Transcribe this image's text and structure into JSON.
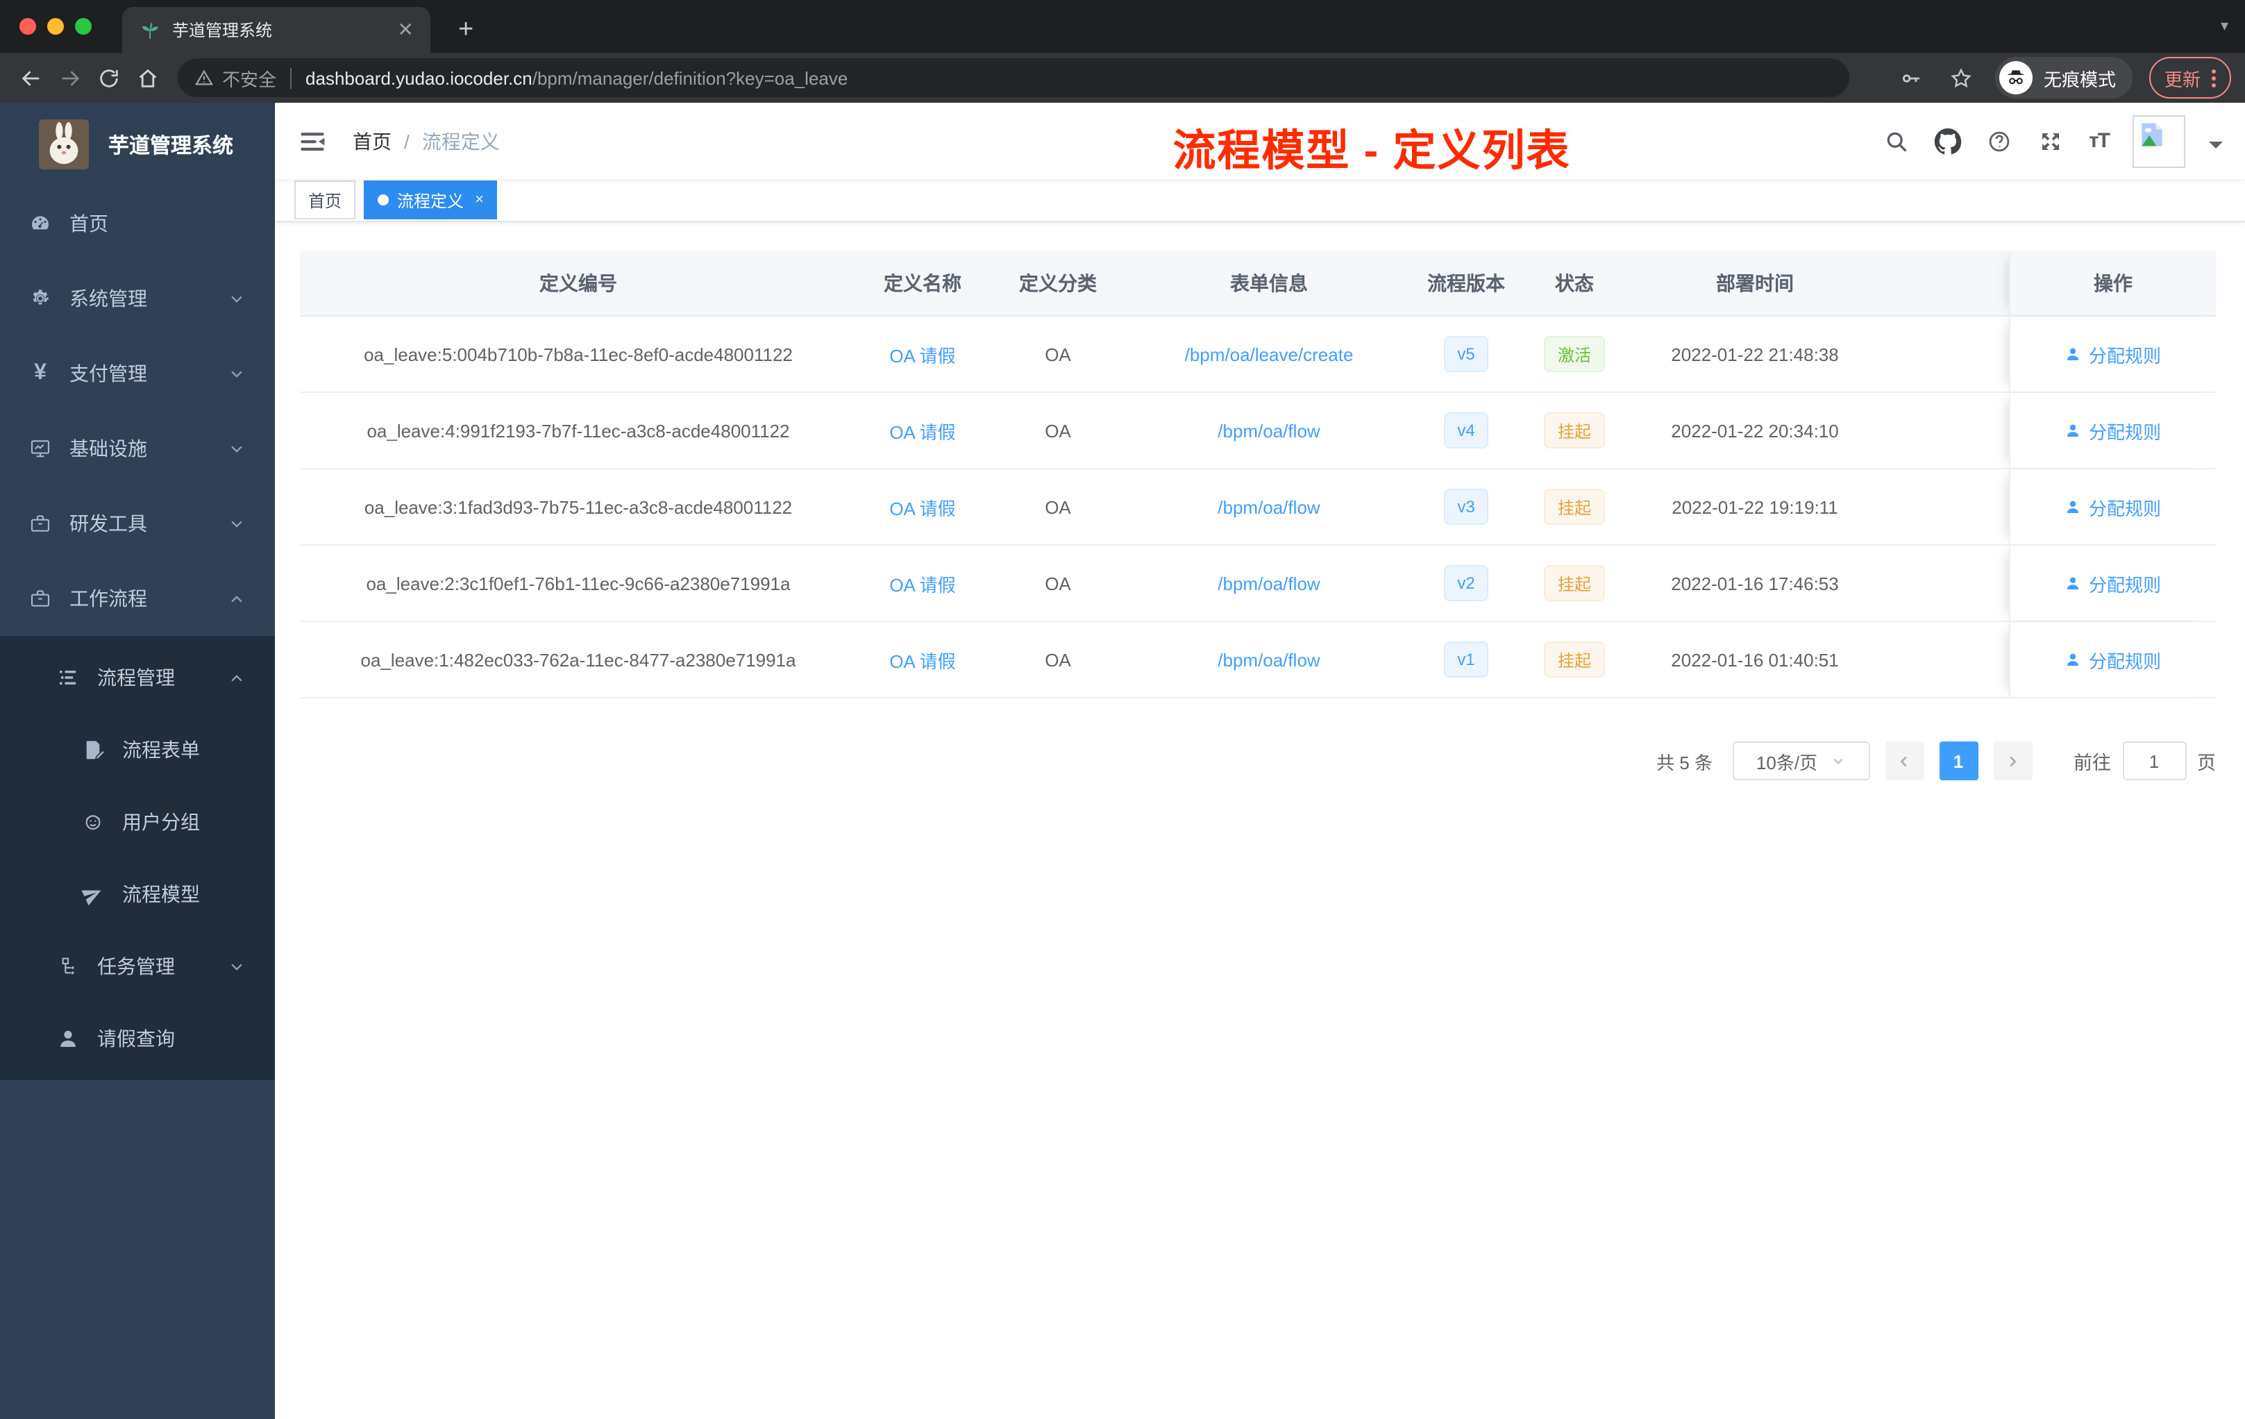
{
  "browser": {
    "tab_title": "芋道管理系统",
    "new_tab_label": "+",
    "security_label": "不安全",
    "url_host": "dashboard.yudao.iocoder.cn",
    "url_path": "/bpm/manager/definition?key=oa_leave",
    "incognito_label": "无痕模式",
    "update_label": "更新"
  },
  "sidebar": {
    "title": "芋道管理系统",
    "items": [
      {
        "key": "home",
        "label": "首页",
        "icon": "gauge-icon",
        "level": 1,
        "chevron": "",
        "submenu": false
      },
      {
        "key": "system",
        "label": "系统管理",
        "icon": "gear-icon",
        "level": 1,
        "chevron": "down",
        "submenu": false
      },
      {
        "key": "payment",
        "label": "支付管理",
        "icon": "yen-icon",
        "level": 1,
        "chevron": "down",
        "submenu": false
      },
      {
        "key": "infrastructure",
        "label": "基础设施",
        "icon": "monitor-icon",
        "level": 1,
        "chevron": "down",
        "submenu": false
      },
      {
        "key": "dev-tools",
        "label": "研发工具",
        "icon": "toolbox-icon",
        "level": 1,
        "chevron": "down",
        "submenu": false
      },
      {
        "key": "workflow",
        "label": "工作流程",
        "icon": "briefcase-icon",
        "level": 1,
        "chevron": "up",
        "submenu": false
      },
      {
        "key": "process-mgmt",
        "label": "流程管理",
        "icon": "list-tree-icon",
        "level": 2,
        "chevron": "up",
        "submenu": true
      },
      {
        "key": "process-form",
        "label": "流程表单",
        "icon": "form-icon",
        "level": 3,
        "chevron": "",
        "submenu": true
      },
      {
        "key": "user-group",
        "label": "用户分组",
        "icon": "usergroup-icon",
        "level": 3,
        "chevron": "",
        "submenu": true
      },
      {
        "key": "process-model",
        "label": "流程模型",
        "icon": "plane-icon",
        "level": 3,
        "chevron": "",
        "submenu": true
      },
      {
        "key": "task-mgmt",
        "label": "任务管理",
        "icon": "tree-icon",
        "level": 2,
        "chevron": "down",
        "submenu": true
      },
      {
        "key": "leave-query",
        "label": "请假查询",
        "icon": "user-icon",
        "level": 2,
        "chevron": "",
        "submenu": true
      }
    ]
  },
  "header": {
    "breadcrumb": [
      "首页",
      "流程定义"
    ],
    "breadcrumb_separator": "/",
    "annotation": "流程模型 - 定义列表"
  },
  "tags": [
    {
      "label": "首页",
      "active": false
    },
    {
      "label": "流程定义",
      "active": true,
      "close": "×"
    }
  ],
  "table": {
    "columns": [
      "定义编号",
      "定义名称",
      "定义分类",
      "表单信息",
      "流程版本",
      "状态",
      "部署时间",
      "操作"
    ],
    "rows": [
      {
        "id": "oa_leave:5:004b710b-7b8a-11ec-8ef0-acde48001122",
        "name": "OA 请假",
        "category": "OA",
        "form": "/bpm/oa/leave/create",
        "version": "v5",
        "status": "激活",
        "status_type": "success",
        "deploy_time": "2022-01-22 21:48:38",
        "action": "分配规则"
      },
      {
        "id": "oa_leave:4:991f2193-7b7f-11ec-a3c8-acde48001122",
        "name": "OA 请假",
        "category": "OA",
        "form": "/bpm/oa/flow",
        "version": "v4",
        "status": "挂起",
        "status_type": "warning",
        "deploy_time": "2022-01-22 20:34:10",
        "action": "分配规则"
      },
      {
        "id": "oa_leave:3:1fad3d93-7b75-11ec-a3c8-acde48001122",
        "name": "OA 请假",
        "category": "OA",
        "form": "/bpm/oa/flow",
        "version": "v3",
        "status": "挂起",
        "status_type": "warning",
        "deploy_time": "2022-01-22 19:19:11",
        "action": "分配规则"
      },
      {
        "id": "oa_leave:2:3c1f0ef1-76b1-11ec-9c66-a2380e71991a",
        "name": "OA 请假",
        "category": "OA",
        "form": "/bpm/oa/flow",
        "version": "v2",
        "status": "挂起",
        "status_type": "warning",
        "deploy_time": "2022-01-16 17:46:53",
        "action": "分配规则"
      },
      {
        "id": "oa_leave:1:482ec033-762a-11ec-8477-a2380e71991a",
        "name": "OA 请假",
        "category": "OA",
        "form": "/bpm/oa/flow",
        "version": "v1",
        "status": "挂起",
        "status_type": "warning",
        "deploy_time": "2022-01-16 01:40:51",
        "action": "分配规则"
      }
    ]
  },
  "pagination": {
    "total": "共 5 条",
    "page_size": "10条/页",
    "current_page": "1",
    "goto_label": "前往",
    "goto_value": "1",
    "goto_suffix": "页"
  },
  "colors": {
    "primary": "#409eff",
    "active_tag": "#2d8cf0",
    "success": "#67c23a",
    "warning": "#e6a23c",
    "annotation_red": "#fe2b00",
    "sidebar_bg": "#304156",
    "submenu_bg": "#1f2d3d"
  }
}
